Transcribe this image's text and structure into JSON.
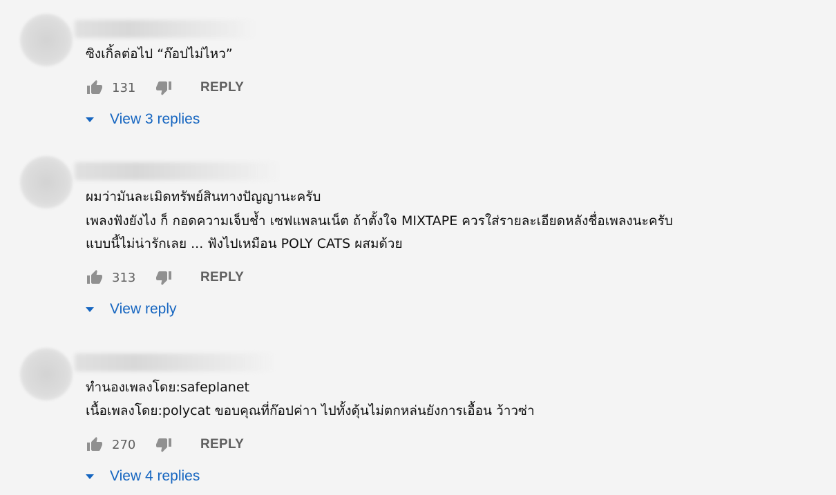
{
  "comments": [
    {
      "lines": [
        "ซิงเกิ้ลต่อไป “ก๊อปไม่ไหว”"
      ],
      "likes": "131",
      "reply_label": "REPLY",
      "replies_label": "View 3 replies"
    },
    {
      "lines": [
        "ผมว่ามันละเมิดทรัพย์สินทางปัญญานะครับ",
        "เพลงฟังยังไง ก็ กอดความเจ็บช้ำ เซฟแพลนเน็ต ถ้าตั้งใจ MIXTAPE ควรใส่รายละเอียดหลังชื่อเพลงนะครับ",
        "แบบนี้ไม่น่ารักเลย ... ฟังไปเหมือน POLY CATS ผสมด้วย"
      ],
      "likes": "313",
      "reply_label": "REPLY",
      "replies_label": "View reply"
    },
    {
      "lines": [
        "ทำนองเพลงโดย:safeplanet",
        "เนื้อเพลงโดย:polycat ขอบคุณที่ก๊อปค่าา ไปทั้งดุ้นไม่ตกหล่นยังการเอื้อน ว้าวซ่า"
      ],
      "likes": "270",
      "reply_label": "REPLY",
      "replies_label": "View 4 replies"
    }
  ],
  "icons": {
    "like": "thumb-up-icon",
    "dislike": "thumb-down-icon",
    "expand": "caret-down-icon"
  },
  "colors": {
    "background": "#f4f4f4",
    "text": "#111111",
    "secondary_text": "#606060",
    "link": "#1565c0"
  }
}
